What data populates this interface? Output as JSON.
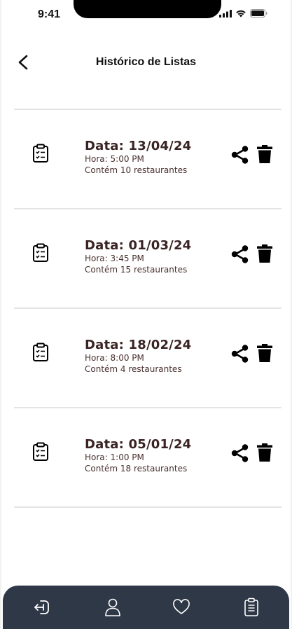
{
  "status_bar": {
    "time": "9:41"
  },
  "header": {
    "title": "Histórico de Listas"
  },
  "lists": [
    {
      "date_label": "Data: 13/04/24",
      "time_label": "Hora: 5:00 PM",
      "count_label": "Contém 10 restaurantes"
    },
    {
      "date_label": "Data: 01/03/24",
      "time_label": "Hora: 3:45 PM",
      "count_label": "Contém 15 restaurantes"
    },
    {
      "date_label": "Data: 18/02/24",
      "time_label": "Hora: 8:00 PM",
      "count_label": "Contém 4 restaurantes"
    },
    {
      "date_label": "Data: 05/01/24",
      "time_label": "Hora: 1:00 PM",
      "count_label": "Contém 18 restaurantes"
    }
  ],
  "icons": {
    "back": "chevron-left-icon",
    "list_item": "clipboard-list-icon",
    "share": "share-icon",
    "delete": "trash-icon",
    "nav": [
      "logout-icon",
      "user-icon",
      "heart-icon",
      "clipboard-icon"
    ]
  },
  "colors": {
    "nav_background": "#2e3847",
    "text_dark": "#3a2323",
    "icon": "#000000"
  }
}
